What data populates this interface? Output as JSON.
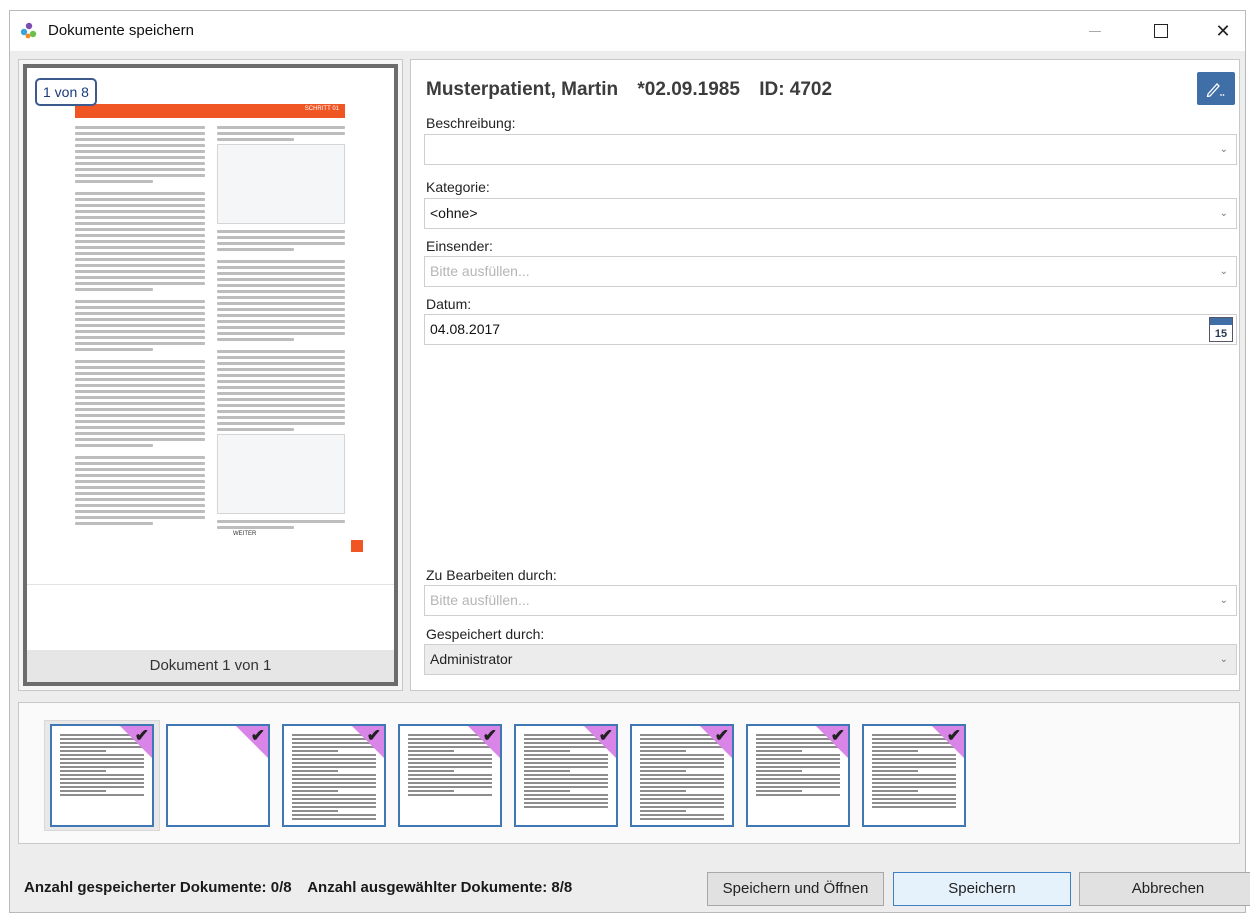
{
  "window": {
    "title": "Dokumente speichern",
    "controls": {
      "minimize": "—",
      "maximize": "☐",
      "close": "✕"
    }
  },
  "preview": {
    "page_counter": "1 von 8",
    "caption": "Dokument 1 von 1",
    "banner_text": "SCHRITT 01",
    "footer_text": "WEITER"
  },
  "form": {
    "patient_name": "Musterpatient, Martin",
    "patient_birth": "*02.09.1985",
    "patient_id": "ID: 4702",
    "edit_icon": "pencil-icon",
    "fields": {
      "beschreibung": {
        "label": "Beschreibung:",
        "value": ""
      },
      "kategorie": {
        "label": "Kategorie:",
        "value": "<ohne>"
      },
      "einsender": {
        "label": "Einsender:",
        "placeholder": "Bitte ausfüllen..."
      },
      "datum": {
        "label": "Datum:",
        "value": "04.08.2017",
        "calendar_day": "15"
      },
      "zu_bearbeiten": {
        "label": "Zu Bearbeiten durch:",
        "placeholder": "Bitte ausfüllen..."
      },
      "gespeichert": {
        "label": "Gespeichert durch:",
        "value": "Administrator"
      }
    }
  },
  "thumbnails": {
    "count": 8,
    "selected_index": 0,
    "check_color": "#d985e8"
  },
  "footer": {
    "saved_count": "Anzahl gespeicherter Dokumente: 0/8",
    "selected_count": "Anzahl ausgewählter Dokumente: 8/8",
    "buttons": {
      "save_open": "Speichern und Öffnen",
      "save": "Speichern",
      "cancel": "Abbrechen"
    }
  },
  "colors": {
    "accent": "#3f6fa6",
    "doc_orange": "#f05524",
    "thumb_border": "#3f78b5"
  }
}
